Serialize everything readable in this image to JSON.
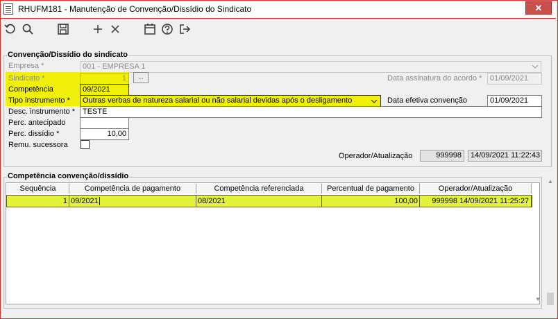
{
  "window": {
    "title": "RHUFM181 - Manutenção de Convenção/Dissídio do Sindicato",
    "close_label": "✕",
    "accent_color": "#d8302b"
  },
  "toolbar": {
    "icons": [
      "refresh-icon",
      "search-icon",
      "save-icon",
      "add-icon",
      "delete-icon",
      "calendar-icon",
      "help-icon",
      "exit-icon"
    ]
  },
  "form": {
    "group_title": "Convenção/Dissídio do sindicato",
    "empresa": {
      "label": "Empresa *",
      "value": "001 - EMPRESA 1"
    },
    "sindicato": {
      "label": "Sindicato *",
      "value": "1",
      "button": "..."
    },
    "competencia": {
      "label": "Competência",
      "value": "09/2021"
    },
    "tipo_instrumento": {
      "label": "Tipo instrumento *",
      "value": "Outras verbas de natureza salarial ou não salarial devidas após o desligamento"
    },
    "desc_instrumento": {
      "label": "Desc. instrumento *",
      "value": "TESTE"
    },
    "perc_antecipado": {
      "label": "Perc. antecipado",
      "value": ""
    },
    "perc_dissidio": {
      "label": "Perc. dissídio *",
      "value": "10,00"
    },
    "remu_sucessora": {
      "label": "Remu. sucessora",
      "checked": false
    },
    "data_assinatura": {
      "label": "Data assinatura do acordo *",
      "value": "01/09/2021"
    },
    "data_efetiva": {
      "label": "Data efetiva convenção",
      "value": "01/09/2021"
    },
    "operador": {
      "label": "Operador/Atualização",
      "code": "999998",
      "datetime": "14/09/2021 11:22:43"
    }
  },
  "grid": {
    "group_title": "Competência convenção/dissídio",
    "columns": [
      "Sequência",
      "Competência de pagamento",
      "Competência referenciada",
      "Percentual de pagamento",
      "Operador/Atualização"
    ],
    "rows": [
      {
        "sequencia": "1",
        "comp_pagamento": "09/2021",
        "comp_referenciada": "08/2021",
        "percentual": "100,00",
        "operador": "999998",
        "atualizacao": "14/09/2021 11:25:27"
      }
    ],
    "highlight_color": "#e5f23a"
  }
}
